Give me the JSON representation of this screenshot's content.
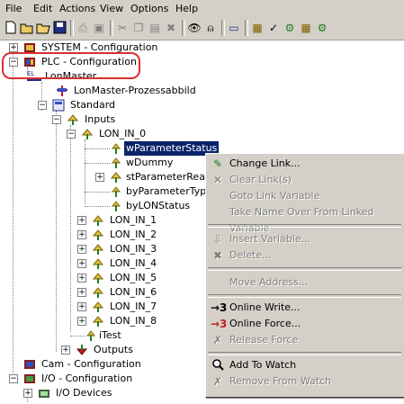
{
  "menu": [
    "File",
    "Edit",
    "Actions",
    "View",
    "Options",
    "Help"
  ],
  "toolbar_icons": [
    "new-icon",
    "open-icon",
    "open-folder-icon",
    "save-icon",
    "print-icon",
    "print-preview-icon",
    "cut-icon",
    "copy-icon",
    "paste-icon",
    "delete-icon",
    "find-icon",
    "find-next-icon",
    "compile-icon",
    "select-target-icon",
    "check-icon",
    "activate-config-icon",
    "run-icon",
    "stop-icon"
  ],
  "tree": {
    "system": "SYSTEM - Configuration",
    "plc": "PLC - Configuration",
    "lonmaster": "LonMaster",
    "lonmaster_pa": "LonMaster-Prozessabbild",
    "standard": "Standard",
    "inputs": "Inputs",
    "lon_in_0": "LON_IN_0",
    "wparam": "wParameterStatus",
    "wdummy": "wDummy",
    "stparam": "stParameterRead",
    "byparamtype": "byParameterType",
    "bylonstatus": "byLONStatus",
    "lon_ins": [
      "LON_IN_1",
      "LON_IN_2",
      "LON_IN_3",
      "LON_IN_4",
      "LON_IN_5",
      "LON_IN_6",
      "LON_IN_7",
      "LON_IN_8"
    ],
    "itest": "iTest",
    "outputs": "Outputs",
    "cam": "Cam - Configuration",
    "io": "I/O - Configuration",
    "io_devices": "I/O Devices"
  },
  "context_menu": {
    "change_link": "Change Link...",
    "clear_links": "Clear Link(s)",
    "goto_link": "Goto Link Variable",
    "take_name": "Take Name Over From Linked Variable",
    "insert_var": "Insert Variable...",
    "delete": "Delete...",
    "move_address": "Move Address...",
    "online_write": "Online Write...",
    "online_force": "Online Force...",
    "release_force": "Release Force",
    "add_watch": "Add To Watch",
    "remove_watch": "Remove From Watch"
  },
  "colors": {
    "selection": "#0a246a",
    "highlight_oval": "#d83030",
    "menu_bg": "#d4d0c8"
  }
}
